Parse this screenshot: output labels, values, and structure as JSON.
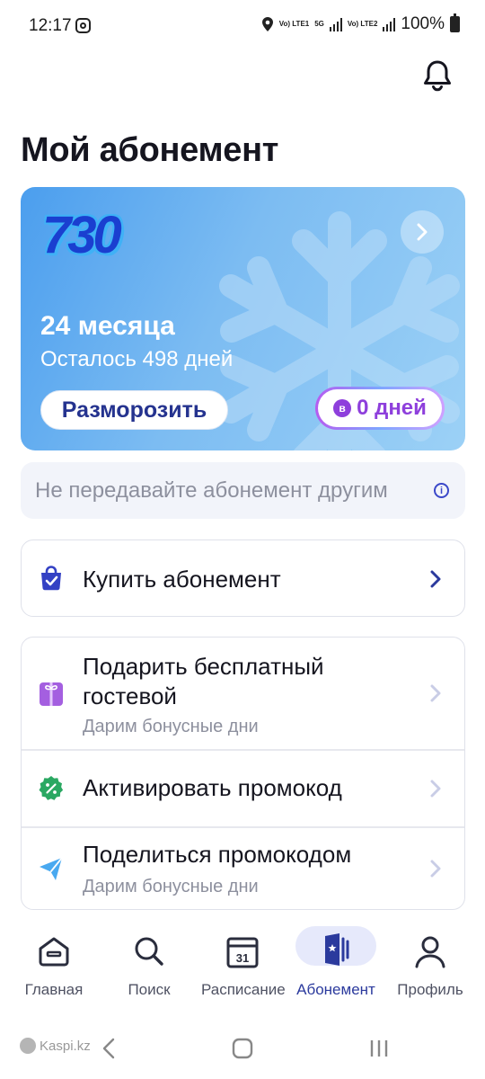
{
  "status_bar": {
    "time": "12:17",
    "net1": "Vo) LTE1",
    "net_5g": "5G",
    "net2": "Vo) LTE2",
    "battery": "100%"
  },
  "header": {
    "title": "Мой абонемент"
  },
  "subscription_card": {
    "logo": "730",
    "months": "24 месяца",
    "remaining": "Осталось 498 дней",
    "unfreeze_label": "Разморозить",
    "bonus_coin": "в",
    "bonus_days": "0 дней"
  },
  "notice": {
    "text": "Не передавайте абонемент другим"
  },
  "buy": {
    "label": "Купить абонемент"
  },
  "actions": [
    {
      "label": "Подарить бесплатный гостевой",
      "sub": "Дарим бонусные дни"
    },
    {
      "label": "Активировать промокод",
      "sub": ""
    },
    {
      "label": "Поделиться промокодом",
      "sub": "Дарим бонусные дни"
    }
  ],
  "tabs": [
    {
      "label": "Главная",
      "icon": "home-icon"
    },
    {
      "label": "Поиск",
      "icon": "search-icon"
    },
    {
      "label": "Расписание",
      "icon": "calendar-icon",
      "calendar_day": "31"
    },
    {
      "label": "Абонемент",
      "icon": "membership-card-icon",
      "active": true
    },
    {
      "label": "Профиль",
      "icon": "profile-icon"
    }
  ],
  "nav_bar": {
    "watermark": "Kaspi.kz"
  },
  "colors": {
    "accent": "#2b3a9d",
    "card_gradient_start": "#4b9eee",
    "card_gradient_end": "#9cd1f6",
    "bonus_purple": "#8e3fdc"
  }
}
